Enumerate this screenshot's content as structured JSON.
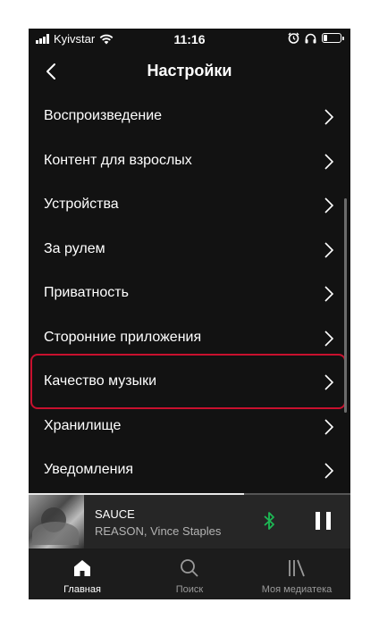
{
  "status_bar": {
    "carrier": "Kyivstar",
    "time": "11:16",
    "icons": [
      "signal-icon",
      "wifi-icon",
      "alarm-icon",
      "headphones-icon",
      "battery-icon"
    ],
    "battery_level": 0.2
  },
  "header": {
    "title": "Настройки",
    "back_icon": "chevron-left-icon"
  },
  "settings": {
    "items": [
      {
        "label": "Воспроизведение"
      },
      {
        "label": "Контент для взрослых"
      },
      {
        "label": "Устройства"
      },
      {
        "label": "За рулем"
      },
      {
        "label": "Приватность"
      },
      {
        "label": "Сторонние приложения"
      },
      {
        "label": "Качество музыки",
        "highlighted": true
      },
      {
        "label": "Хранилище"
      },
      {
        "label": "Уведомления"
      }
    ]
  },
  "now_playing": {
    "title": "SAUCE",
    "artist": "REASON, Vince Staples",
    "progress": 0.67,
    "bluetooth_icon": "bluetooth-icon",
    "pause_icon": "pause-icon"
  },
  "tabbar": {
    "tabs": [
      {
        "label": "Главная",
        "icon": "home-icon",
        "active": true
      },
      {
        "label": "Поиск",
        "icon": "search-icon",
        "active": false
      },
      {
        "label": "Моя медиатека",
        "icon": "library-icon",
        "active": false
      }
    ]
  },
  "colors": {
    "background": "#121212",
    "highlight": "#c8102e",
    "bluetooth": "#1db954"
  }
}
